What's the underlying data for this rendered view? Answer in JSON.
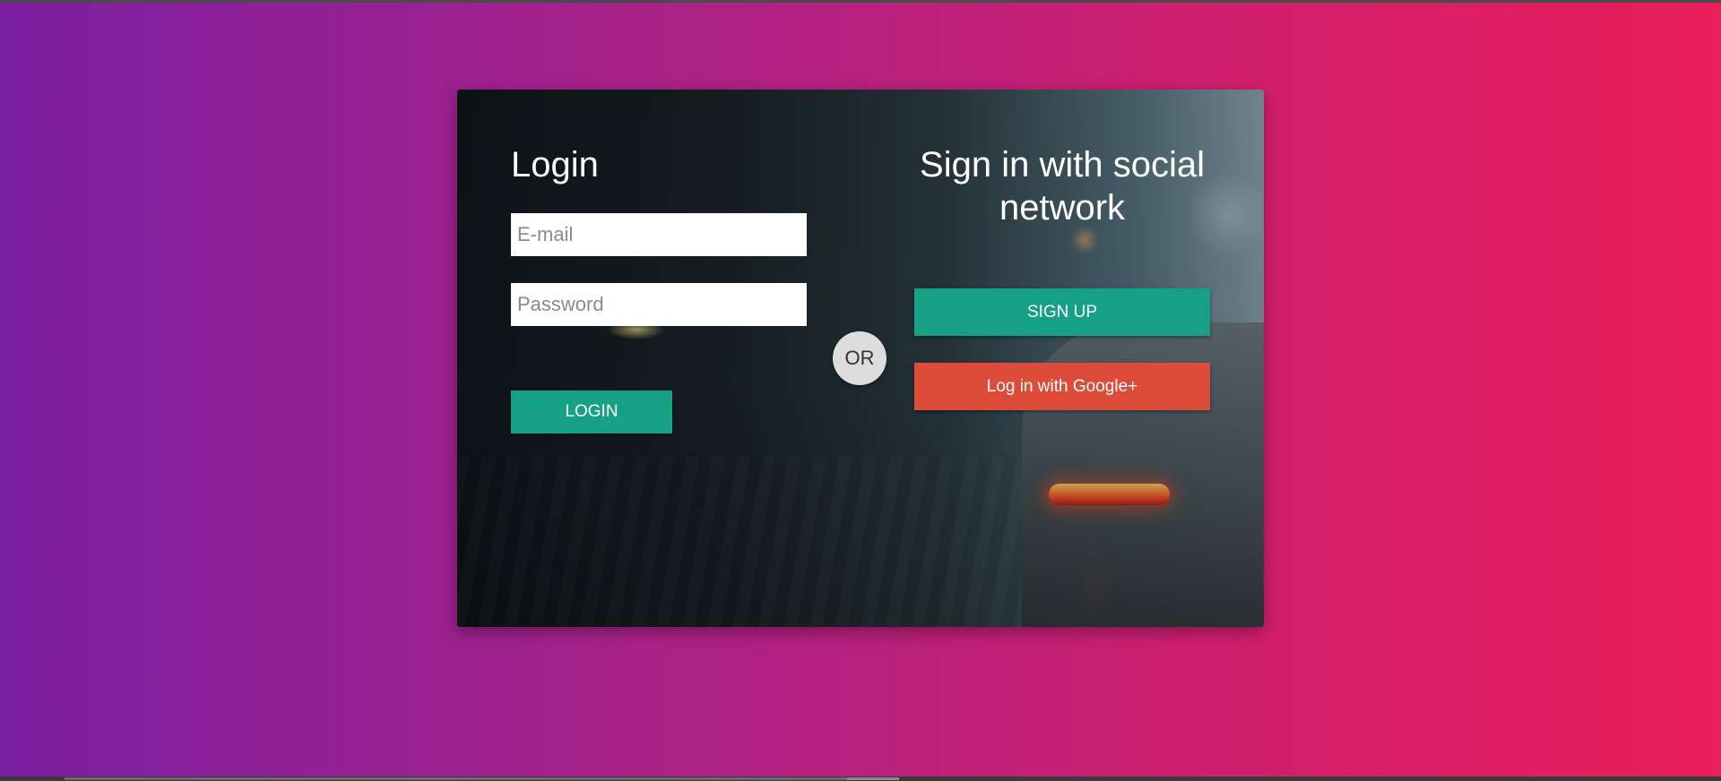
{
  "login": {
    "title": "Login",
    "email_placeholder": "E-mail",
    "password_placeholder": "Password",
    "button_label": "LOGIN"
  },
  "divider": {
    "label": "OR"
  },
  "social": {
    "title": "Sign in with social network",
    "signup_label": "SIGN UP",
    "google_label": "Log in with Google+"
  },
  "colors": {
    "primary_button": "#16a085",
    "google_button": "#dd4b39",
    "gradient_start": "#7b1fa2",
    "gradient_end": "#e91e5a"
  },
  "icons": {
    "background": "city-street-car-photo"
  }
}
